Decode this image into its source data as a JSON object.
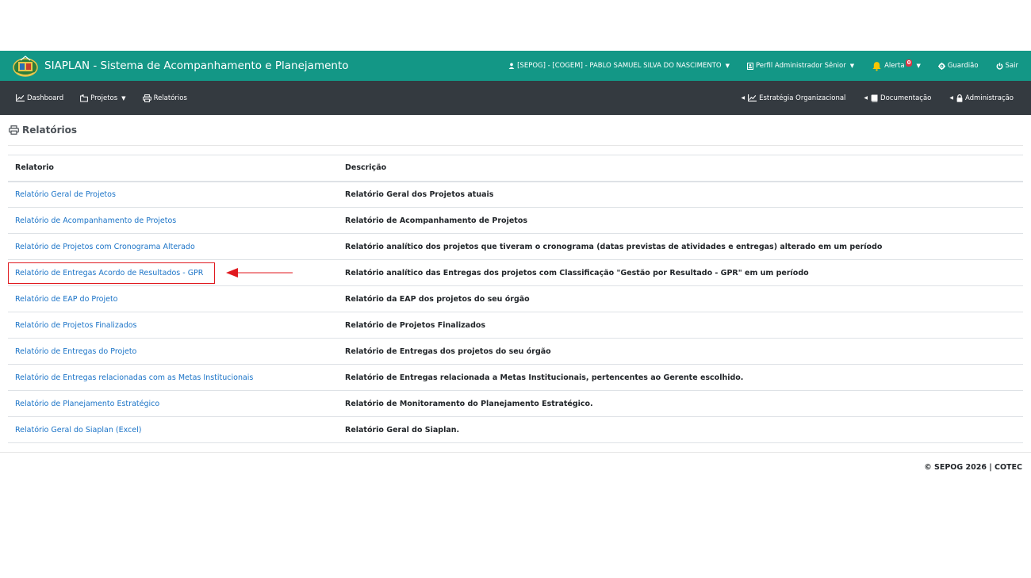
{
  "header": {
    "app_title": "SIAPLAN - Sistema de Acompanhamento e Planejamento",
    "user_menu": "[SEPOG] - [COGEM] - PABLO SAMUEL SILVA DO NASCIMENTO",
    "profile_menu": "Perfil Administrador Sênior",
    "alerts_label": "Alerta",
    "alerts_count": "0",
    "guardian_label": "Guardião",
    "logout_label": "Sair"
  },
  "nav": {
    "dashboard": "Dashboard",
    "projetos": "Projetos",
    "relatorios": "Relatórios",
    "estrategia": "Estratégia Organizacional",
    "documentacao": "Documentação",
    "administracao": "Administração"
  },
  "page": {
    "title": "Relatórios"
  },
  "table": {
    "headers": [
      "Relatorio",
      "Descrição"
    ],
    "rows": [
      {
        "report": "Relatório Geral de Projetos",
        "description": "Relatório Geral dos Projetos atuais"
      },
      {
        "report": "Relatório de Acompanhamento de Projetos",
        "description": "Relatório de Acompanhamento de Projetos"
      },
      {
        "report": "Relatório de Projetos com Cronograma Alterado",
        "description": "Relatório analítico dos projetos que tiveram o cronograma (datas previstas de atividades e entregas) alterado em um período"
      },
      {
        "report": "Relatório de Entregas Acordo de Resultados - GPR",
        "description": "Relatório analítico das Entregas dos projetos com Classificação \"Gestão por Resultado - GPR\" em um período"
      },
      {
        "report": "Relatório de EAP do Projeto",
        "description": "Relatório da EAP dos projetos do seu órgão"
      },
      {
        "report": "Relatório de Projetos Finalizados",
        "description": "Relatório de Projetos Finalizados"
      },
      {
        "report": "Relatório de Entregas do Projeto",
        "description": "Relatório de Entregas dos projetos do seu órgão"
      },
      {
        "report": "Relatório de Entregas relacionadas com as Metas Institucionais",
        "description": "Relatório de Entregas relacionada a Metas Institucionais, pertencentes ao Gerente escolhido."
      },
      {
        "report": "Relatório de Planejamento Estratégico",
        "description": "Relatório de Monitoramento do Planejamento Estratégico."
      },
      {
        "report": "Relatório Geral do Siaplan (Excel)",
        "description": "Relatório Geral do Siaplan."
      }
    ]
  },
  "footer": {
    "text": "© SEPOG 2026 | COTEC"
  },
  "colors": {
    "topbar": "#139786",
    "navbar": "#343a40",
    "link": "#1a73c7",
    "highlight": "#e0191f",
    "alert_bell": "#f7c600"
  }
}
